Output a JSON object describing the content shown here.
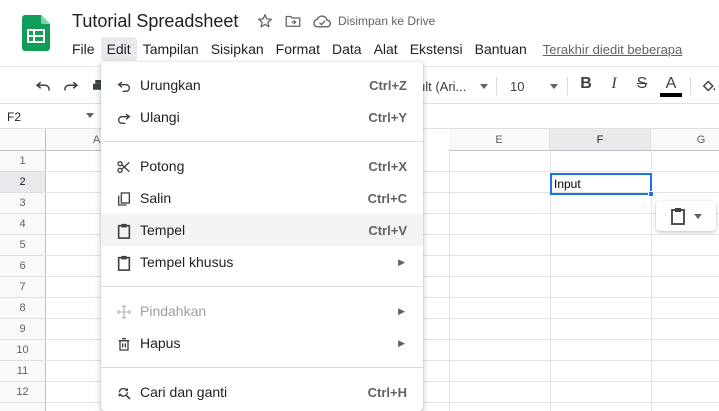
{
  "app": {
    "doc_title": "Tutorial Spreadsheet",
    "saved_status": "Disimpan ke Drive",
    "last_edit": "Terakhir diedit beberapa",
    "star_icon": "star-icon",
    "move_icon": "folder-move-icon",
    "cloud_icon": "cloud-done-icon",
    "brand_color": "#0f9d58"
  },
  "menubar": [
    {
      "label": "File"
    },
    {
      "label": "Edit",
      "active": true
    },
    {
      "label": "Tampilan"
    },
    {
      "label": "Sisipkan"
    },
    {
      "label": "Format"
    },
    {
      "label": "Data"
    },
    {
      "label": "Alat"
    },
    {
      "label": "Ekstensi"
    },
    {
      "label": "Bantuan"
    }
  ],
  "toolbar": {
    "font": "ult (Ari...",
    "font_size": "10",
    "bold": "B",
    "italic": "I",
    "strike": "S",
    "text_color": "A"
  },
  "name_box": "F2",
  "grid": {
    "columns": [
      "A",
      "E",
      "F",
      "G"
    ],
    "selected_column": "F",
    "rows": [
      "1",
      "2",
      "3",
      "4",
      "5",
      "6",
      "7",
      "8",
      "9",
      "10",
      "11",
      "12"
    ],
    "selected_row": "2",
    "cells": {
      "F2": "Input"
    },
    "selection_color": "#1a73e8"
  },
  "edit_menu": {
    "groups": [
      [
        {
          "icon": "undo-icon",
          "label": "Urungkan",
          "shortcut": "Ctrl+Z"
        },
        {
          "icon": "redo-icon",
          "label": "Ulangi",
          "shortcut": "Ctrl+Y"
        }
      ],
      [
        {
          "icon": "scissors-icon",
          "label": "Potong",
          "shortcut": "Ctrl+X"
        },
        {
          "icon": "copy-icon",
          "label": "Salin",
          "shortcut": "Ctrl+C"
        },
        {
          "icon": "clipboard-icon",
          "label": "Tempel",
          "shortcut": "Ctrl+V",
          "hover": true
        },
        {
          "icon": "clipboard-icon",
          "label": "Tempel khusus",
          "submenu": true
        }
      ],
      [
        {
          "icon": "move-icon",
          "label": "Pindahkan",
          "submenu": true,
          "disabled": true
        },
        {
          "icon": "trash-icon",
          "label": "Hapus",
          "submenu": true
        }
      ],
      [
        {
          "icon": "find-replace-icon",
          "label": "Cari dan ganti",
          "shortcut": "Ctrl+H"
        }
      ]
    ]
  }
}
